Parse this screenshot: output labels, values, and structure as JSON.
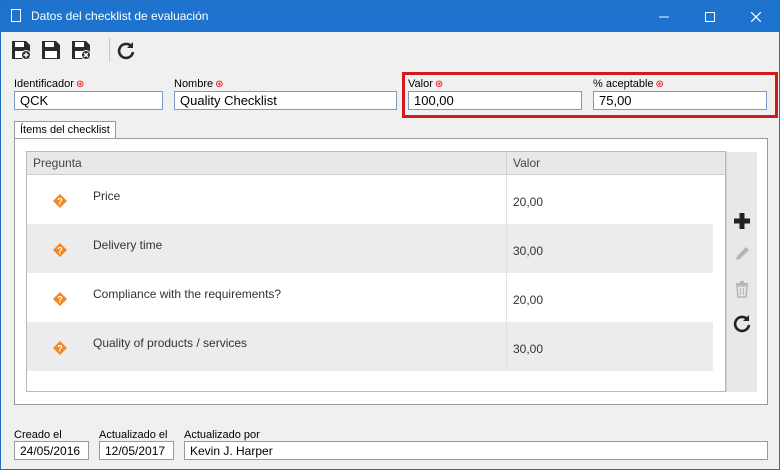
{
  "window": {
    "title": "Datos del checklist de evaluación"
  },
  "toolbar": {
    "buttons": [
      {
        "name": "save-new-icon"
      },
      {
        "name": "save-icon"
      },
      {
        "name": "save-close-icon"
      },
      {
        "name": "refresh-icon"
      }
    ]
  },
  "fields": {
    "identificador": {
      "label": "Identificador",
      "value": "QCK"
    },
    "nombre": {
      "label": "Nombre",
      "value": "Quality Checklist"
    },
    "valor": {
      "label": "Valor",
      "value": "100,00"
    },
    "aceptable": {
      "label": "% aceptable",
      "value": "75,00"
    }
  },
  "tab": {
    "label": "Ítems del checklist"
  },
  "grid": {
    "columns": [
      "Pregunta",
      "Valor"
    ],
    "rows": [
      {
        "question": "Price",
        "value": "20,00"
      },
      {
        "question": "Delivery time",
        "value": "30,00"
      },
      {
        "question": "Compliance with the requirements?",
        "value": "20,00"
      },
      {
        "question": "Quality of products / services",
        "value": "30,00"
      }
    ]
  },
  "footer": {
    "creado": {
      "label": "Creado el",
      "value": "24/05/2016"
    },
    "actualizado": {
      "label": "Actualizado el",
      "value": "12/05/2017"
    },
    "por": {
      "label": "Actualizado por",
      "value": "Kevin J. Harper"
    }
  },
  "colors": {
    "titlebar": "#1e73cf",
    "highlight": "#d2191c",
    "question_icon": "#f08a24",
    "row_alt": "#ececec"
  }
}
